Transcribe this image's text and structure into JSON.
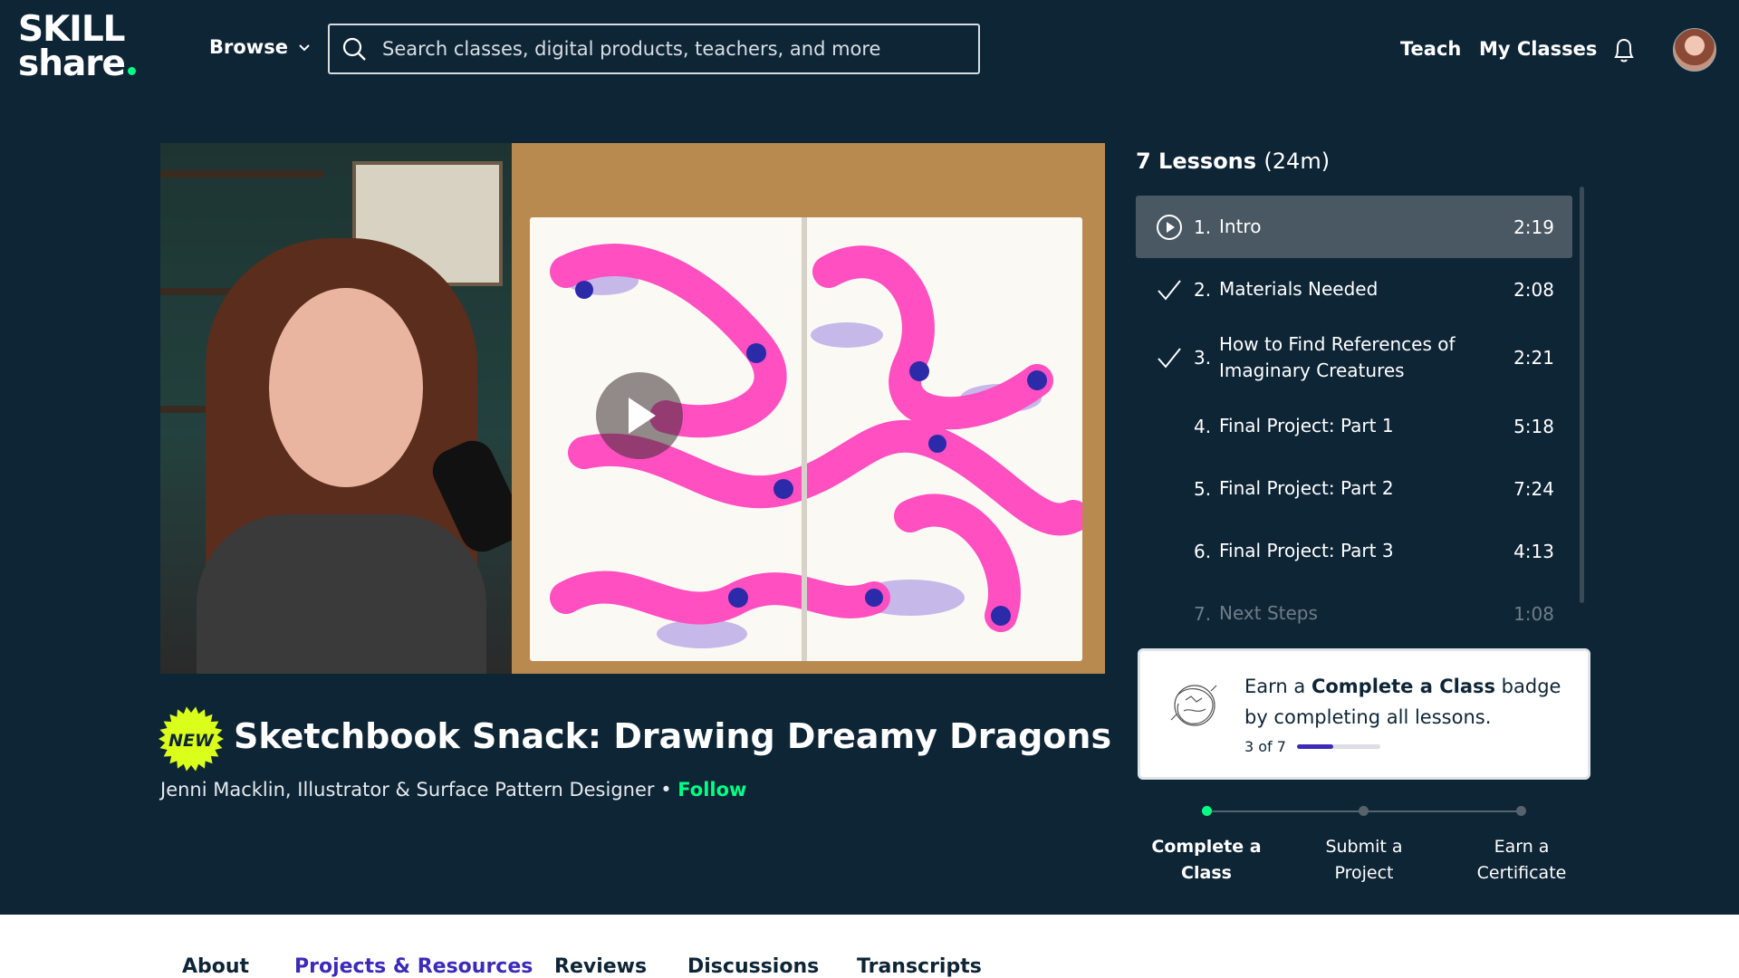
{
  "header": {
    "logo_line1": "SKILL",
    "logo_line2": "share",
    "browse_label": "Browse",
    "search_placeholder": "Search classes, digital products, teachers, and more",
    "teach_label": "Teach",
    "my_classes_label": "My Classes",
    "icons": [
      "search-icon",
      "chevron-down-icon",
      "bell-icon"
    ]
  },
  "video": {
    "play_icon": "play-icon"
  },
  "course": {
    "new_badge": "NEW",
    "title": "Sketchbook Snack: Drawing Dreamy Dragons",
    "teacher": "Jenni Macklin, Illustrator & Surface Pattern Designer",
    "separator": "•",
    "follow_label": "Follow"
  },
  "lessons": {
    "count_label": "7 Lessons",
    "duration_label": "(24m)",
    "items": [
      {
        "num": "1.",
        "title": "Intro",
        "time": "2:19",
        "state": "playing"
      },
      {
        "num": "2.",
        "title": "Materials Needed",
        "time": "2:08",
        "state": "done"
      },
      {
        "num": "3.",
        "title": "How to Find References of Imaginary Creatures",
        "time": "2:21",
        "state": "done"
      },
      {
        "num": "4.",
        "title": "Final Project: Part 1",
        "time": "5:18",
        "state": "todo"
      },
      {
        "num": "5.",
        "title": "Final Project: Part 2",
        "time": "7:24",
        "state": "todo"
      },
      {
        "num": "6.",
        "title": "Final Project: Part 3",
        "time": "4:13",
        "state": "todo"
      },
      {
        "num": "7.",
        "title": "Next Steps",
        "time": "1:08",
        "state": "todo"
      }
    ]
  },
  "badge_card": {
    "text_pre": "Earn a ",
    "text_bold": "Complete a Class",
    "text_post": " badge by completing all lessons.",
    "progress_label": "3 of 7",
    "progress_fraction": 0.43
  },
  "steps": [
    {
      "label": "Complete a Class",
      "active": true
    },
    {
      "label": "Submit a Project",
      "active": false
    },
    {
      "label": "Earn a Certificate",
      "active": false
    }
  ],
  "tabs": [
    {
      "label": "About",
      "active": false
    },
    {
      "label": "Projects & Resources",
      "active": true
    },
    {
      "label": "Reviews",
      "active": false
    },
    {
      "label": "Discussions",
      "active": false
    },
    {
      "label": "Transcripts",
      "active": false
    }
  ],
  "colors": {
    "background": "#0e2536",
    "accent_green": "#00ff84",
    "accent_purple": "#3c2bb8",
    "active_row": "#4a5863"
  }
}
